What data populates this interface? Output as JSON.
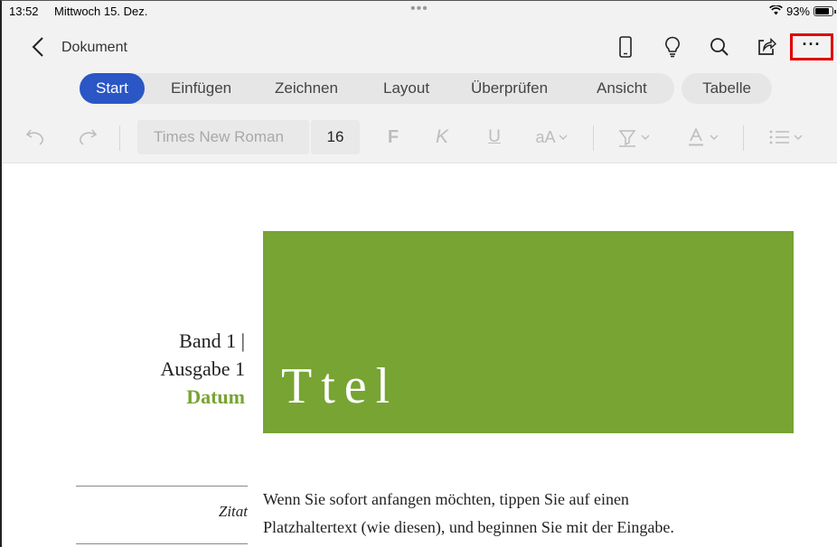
{
  "status_bar": {
    "time": "13:52",
    "date": "Mittwoch 15. Dez.",
    "multitask_dots": "•••",
    "battery": "93%",
    "wifi_icon": "wifi-icon",
    "battery_icon": "battery-icon"
  },
  "title_bar": {
    "back_icon": "chevron-left-icon",
    "title": "Dokument",
    "icons": [
      "phone-layout-icon",
      "lightbulb-icon",
      "search-icon",
      "share-icon",
      "more-icon"
    ],
    "more_label": "···"
  },
  "ribbon": {
    "tabs": [
      {
        "label": "Start",
        "active": true
      },
      {
        "label": "Einfügen"
      },
      {
        "label": "Zeichnen"
      },
      {
        "label": "Layout"
      },
      {
        "label": "Überprüfen"
      },
      {
        "label": "Ansicht"
      }
    ],
    "context_tab": "Tabelle"
  },
  "toolbar": {
    "font_name": "Times New Roman",
    "font_size": "16",
    "bold": "F",
    "italic": "K",
    "underline": "U",
    "font_size_menu": "aA",
    "chevron": "⌄"
  },
  "document": {
    "banner_title": "Ttel",
    "meta_line1": "Band 1 |",
    "meta_line2": "Ausgabe 1",
    "meta_date": "Datum",
    "quote_label": "Zitat",
    "body_line1": "Wenn Sie sofort anfangen möchten, tippen Sie auf einen",
    "body_line2": "Platzhaltertext (wie diesen), und beginnen Sie mit der Eingabe."
  },
  "colors": {
    "accent_blue": "#2a56c6",
    "banner_green": "#77a433",
    "highlight_red": "#e00000"
  }
}
